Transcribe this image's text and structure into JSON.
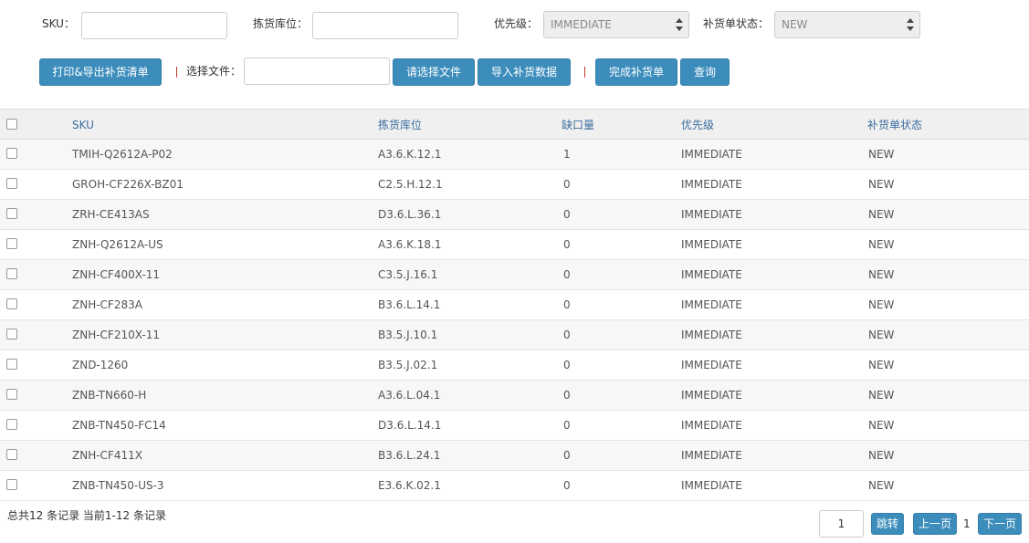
{
  "filters": {
    "sku_label": "SKU：",
    "location_label": "拣货库位：",
    "priority_label": "优先级：",
    "priority_value": "IMMEDIATE",
    "status_label": "补货单状态：",
    "status_value": "NEW"
  },
  "toolbar": {
    "print_export_label": "打印&导出补货清单",
    "file_label": "选择文件：",
    "choose_file_label": "请选择文件",
    "import_label": "导入补货数据",
    "complete_label": "完成补货单",
    "query_label": "查询"
  },
  "table": {
    "headers": [
      "SKU",
      "拣货库位",
      "缺口量",
      "优先级",
      "补货单状态"
    ],
    "rows": [
      [
        "TMIH-Q2612A-P02",
        "A3.6.K.12.1",
        "1",
        "IMMEDIATE",
        "NEW"
      ],
      [
        "GROH-CF226X-BZ01",
        "C2.5.H.12.1",
        "0",
        "IMMEDIATE",
        "NEW"
      ],
      [
        "ZRH-CE413AS",
        "D3.6.L.36.1",
        "0",
        "IMMEDIATE",
        "NEW"
      ],
      [
        "ZNH-Q2612A-US",
        "A3.6.K.18.1",
        "0",
        "IMMEDIATE",
        "NEW"
      ],
      [
        "ZNH-CF400X-11",
        "C3.5.J.16.1",
        "0",
        "IMMEDIATE",
        "NEW"
      ],
      [
        "ZNH-CF283A",
        "B3.6.L.14.1",
        "0",
        "IMMEDIATE",
        "NEW"
      ],
      [
        "ZNH-CF210X-11",
        "B3.5.J.10.1",
        "0",
        "IMMEDIATE",
        "NEW"
      ],
      [
        "ZND-1260",
        "B3.5.J.02.1",
        "0",
        "IMMEDIATE",
        "NEW"
      ],
      [
        "ZNB-TN660-H",
        "A3.6.L.04.1",
        "0",
        "IMMEDIATE",
        "NEW"
      ],
      [
        "ZNB-TN450-FC14",
        "D3.6.L.14.1",
        "0",
        "IMMEDIATE",
        "NEW"
      ],
      [
        "ZNH-CF411X",
        "B3.6.L.24.1",
        "0",
        "IMMEDIATE",
        "NEW"
      ],
      [
        "ZNB-TN450-US-3",
        "E3.6.K.02.1",
        "0",
        "IMMEDIATE",
        "NEW"
      ]
    ]
  },
  "footer": {
    "summary": "总共12 条记录 当前1-12 条记录",
    "page_input_value": "1",
    "jump_label": "跳转",
    "prev_label": "上一页",
    "current_page": "1",
    "next_label": "下一页"
  },
  "colors": {
    "primary": "#3c8dbc",
    "header_text": "#3c6d9e",
    "separator": "#c0392b"
  }
}
